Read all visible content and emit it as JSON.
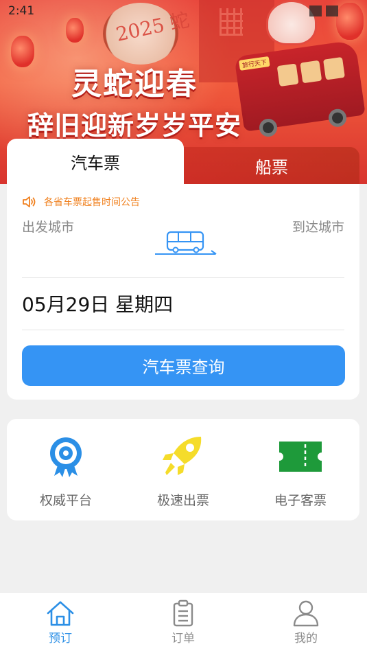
{
  "status_bar": {
    "time": "2:41"
  },
  "banner": {
    "line1": "灵蛇迎春",
    "line2": "辞旧迎新岁岁平安",
    "drum_text": "2025 蛇",
    "bus_sign": "旅行天下"
  },
  "tabs": [
    {
      "label": "汽车票",
      "active": true
    },
    {
      "label": "船票",
      "active": false
    }
  ],
  "booking": {
    "notice": "各省车票起售时间公告",
    "from_city_placeholder": "出发城市",
    "to_city_placeholder": "到达城市",
    "date": "05月29日 星期四",
    "search_button": "汽车票查询"
  },
  "features": [
    {
      "label": "权威平台",
      "icon": "award-badge-icon"
    },
    {
      "label": "极速出票",
      "icon": "rocket-icon"
    },
    {
      "label": "电子客票",
      "icon": "ticket-icon"
    }
  ],
  "bottom_nav": [
    {
      "label": "预订",
      "icon": "home-icon",
      "active": true
    },
    {
      "label": "订单",
      "icon": "clipboard-icon",
      "active": false
    },
    {
      "label": "我的",
      "icon": "user-icon",
      "active": false
    }
  ],
  "colors": {
    "primary_blue": "#3594f4",
    "notice_orange": "#f0801e",
    "banner_red": "#e8443a",
    "feature_yellow": "#f5dc2a",
    "feature_green": "#1e9a3a"
  }
}
